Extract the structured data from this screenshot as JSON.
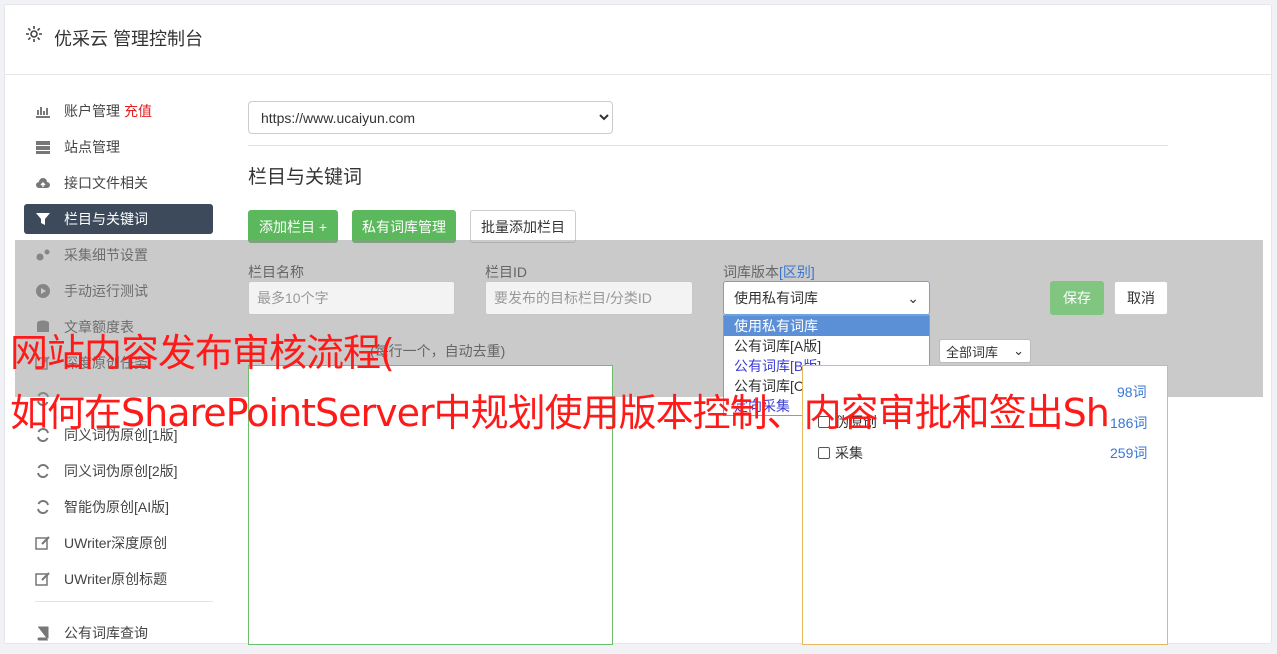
{
  "header": {
    "title": "优采云 管理控制台"
  },
  "sidebar": {
    "items": [
      {
        "label": "账户管理",
        "extra": "充值",
        "icon": "bar-chart-icon"
      },
      {
        "label": "站点管理",
        "icon": "server-icon"
      },
      {
        "label": "接口文件相关",
        "icon": "cloud-upload-icon"
      },
      {
        "label": "栏目与关键词",
        "icon": "filter-icon",
        "active": true
      },
      {
        "label": "采集细节设置",
        "icon": "gears-icon"
      },
      {
        "label": "手动运行测试",
        "icon": "play-circle-icon"
      },
      {
        "label": "文章额度表",
        "icon": "database-icon"
      },
      {
        "label": "深度原创任务",
        "icon": "edit-icon"
      },
      {
        "label": "",
        "icon": "refresh-icon"
      },
      {
        "label": "同义词伪原创[1版]",
        "icon": "refresh-icon"
      },
      {
        "label": "同义词伪原创[2版]",
        "icon": "refresh-icon"
      },
      {
        "label": "智能伪原创[AI版]",
        "icon": "refresh-icon"
      },
      {
        "label": "UWriter深度原创",
        "icon": "edit-icon"
      },
      {
        "label": "UWriter原创标题",
        "icon": "edit-icon"
      },
      {
        "label": "公有词库查询",
        "icon": "book-icon"
      }
    ]
  },
  "site_select": {
    "value": "https://www.ucaiyun.com"
  },
  "section_title": "栏目与关键词",
  "buttons": {
    "add_column": "添加栏目 +",
    "private_lib": "私有词库管理",
    "batch_add": "批量添加栏目",
    "save": "保存",
    "cancel": "取消"
  },
  "form": {
    "column_name_label": "栏目名称",
    "column_name_placeholder": "最多10个字",
    "column_id_label": "栏目ID",
    "column_id_placeholder": "要发布的目标栏目/分类ID",
    "lib_version_label": "词库版本",
    "lib_version_link": "[区别]",
    "lib_version_value": "使用私有词库",
    "lib_version_options": [
      "使用私有词库",
      "公有词库[A版]",
      "公有词库[B版]",
      "公有词库[C版]",
      "定向采集"
    ],
    "keywords_label": "(每行一个，自动去重)",
    "all_libs": "全部词库"
  },
  "lib_list": [
    {
      "label": "伪原创",
      "count": "186词"
    },
    {
      "label": "采集",
      "count": "259词"
    }
  ],
  "lib_list_top_count": "98词",
  "watermark": {
    "line1": "网站内容发布审核流程(",
    "line2": "如何在SharePointServer中规划使用版本控制、内容审批和签出Sh"
  },
  "colors": {
    "green": "#5cb85c",
    "active_nav": "#3d4a5c",
    "link": "#3877d4",
    "watermark": "#ff1a1a"
  }
}
